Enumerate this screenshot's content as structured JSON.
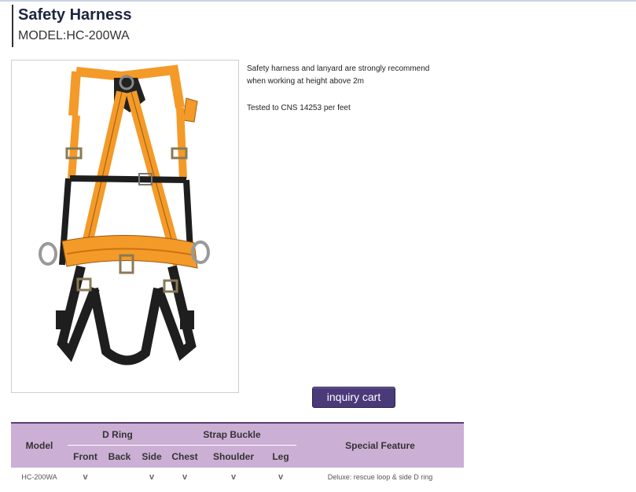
{
  "product": {
    "title": "Safety Harness",
    "model_label": "MODEL:",
    "model": "HC-200WA"
  },
  "description": {
    "line1": "Safety harness and lanyard are strongly recommend",
    "line2": "when working at height above 2m",
    "line3": "Tested to CNS 14253 per feet"
  },
  "button": {
    "label": "inquiry cart"
  },
  "colors": {
    "strap_orange": "#f39a28",
    "strap_black": "#1e1e1e",
    "table_header": "#ccafd5",
    "table_border": "#5b3d74",
    "button_bg": "#4a3a7a"
  },
  "table": {
    "headers": {
      "model": "Model",
      "d_ring": "D Ring",
      "strap_buckle": "Strap Buckle",
      "special_feature": "Special Feature",
      "front": "Front",
      "back": "Back",
      "side": "Side",
      "chest": "Chest",
      "shoulder": "Shoulder",
      "leg": "Leg"
    },
    "row": {
      "model": "HC-200WA",
      "front": "v",
      "back": "",
      "side": "v",
      "chest": "v",
      "shoulder": "v",
      "leg": "v",
      "feature": "Deluxe: rescue loop & side D ring"
    }
  }
}
